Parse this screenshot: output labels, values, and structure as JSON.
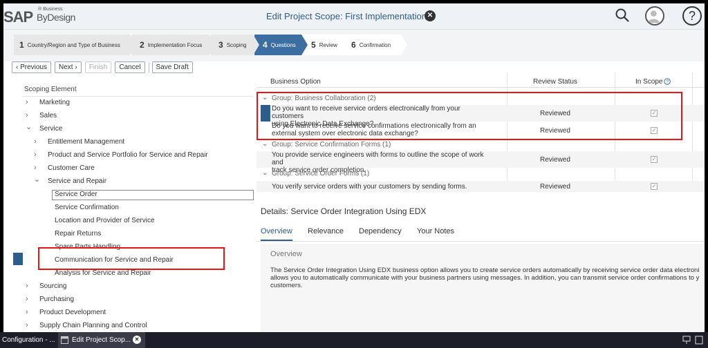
{
  "shell": {
    "logo_sap": "SAP",
    "logo_super": "® Business",
    "logo_sub": "ByDesign",
    "title": "Edit Project Scope: First Implementation",
    "close_glyph": "✕",
    "help_glyph": "?"
  },
  "roadmap": [
    {
      "num": "1",
      "label": "Country/Region and Type of Business",
      "state": "done"
    },
    {
      "num": "2",
      "label": "Implementation Focus",
      "state": "done"
    },
    {
      "num": "3",
      "label": "Scoping",
      "state": "done"
    },
    {
      "num": "4",
      "label": "Questions",
      "state": "active"
    },
    {
      "num": "5",
      "label": "Review",
      "state": "future"
    },
    {
      "num": "6",
      "label": "Confirmation",
      "state": "future"
    }
  ],
  "toolbar": {
    "previous": "‹ Previous",
    "next": "Next ›",
    "finish": "Finish",
    "cancel": "Cancel",
    "save_draft": "Save Draft"
  },
  "tree": {
    "header": "Scoping Element",
    "items": [
      {
        "label": "Marketing",
        "arrow": "›",
        "level": 0
      },
      {
        "label": "Sales",
        "arrow": "›",
        "level": 0
      },
      {
        "label": "Service",
        "arrow": "⌄",
        "level": 0
      },
      {
        "label": "Entitlement Management",
        "arrow": "›",
        "level": 1
      },
      {
        "label": "Product and Service Portfolio for Service and Repair",
        "arrow": "›",
        "level": 1
      },
      {
        "label": "Customer Care",
        "arrow": "›",
        "level": 1
      },
      {
        "label": "Service and Repair",
        "arrow": "⌄",
        "level": 1
      },
      {
        "label": "Service Order",
        "arrow": "",
        "level": 2
      },
      {
        "label": "Service Confirmation",
        "arrow": "",
        "level": 2
      },
      {
        "label": "Location and Provider of Service",
        "arrow": "",
        "level": 2
      },
      {
        "label": "Repair Returns",
        "arrow": "",
        "level": 2
      },
      {
        "label": "Spare Parts Handling",
        "arrow": "",
        "level": 2
      },
      {
        "label": "Communication for Service and Repair",
        "arrow": "",
        "level": 2
      },
      {
        "label": "Analysis for Service and Repair",
        "arrow": "",
        "level": 2
      },
      {
        "label": "Sourcing",
        "arrow": "›",
        "level": 0
      },
      {
        "label": "Purchasing",
        "arrow": "›",
        "level": 0
      },
      {
        "label": "Product Development",
        "arrow": "›",
        "level": 0
      },
      {
        "label": "Supply Chain Planning and Control",
        "arrow": "›",
        "level": 0
      }
    ]
  },
  "table": {
    "col_option": "Business Option",
    "col_status": "Review Status",
    "col_scope": "In Scope",
    "groups": [
      {
        "label": "Group: Business Collaboration (2)",
        "rows": [
          {
            "line1": "Do you want to receive service orders electronically from your customers",
            "line2": "using Electronic Data Exchange?",
            "status": "Reviewed",
            "in_scope": "✓"
          },
          {
            "line1": "Do you want to receive service confirmations electronically from an",
            "line2": "external system over electronic data exchange?",
            "status": "Reviewed",
            "in_scope": "✓"
          }
        ]
      },
      {
        "label": "Group: Service Confirmation Forms (1)",
        "rows": [
          {
            "line1": "You provide service engineers with forms to outline the scope of work and",
            "line2": "track service order completion.",
            "status": "Reviewed",
            "in_scope": "✓"
          }
        ]
      },
      {
        "label": "Group: Service Order Forms (1)",
        "rows": [
          {
            "line1": "You verify service orders with your customers by sending forms.",
            "line2": "",
            "status": "Reviewed",
            "in_scope": "✓"
          }
        ]
      }
    ]
  },
  "details": {
    "title": "Details: Service Order Integration Using EDX",
    "tabs": [
      "Overview",
      "Relevance",
      "Dependency",
      "Your Notes"
    ],
    "overview_title": "Overview",
    "overview_lines": [
      "The Service Order Integration Using EDX business option allows you to create service orders automatically by receiving service order data electroni",
      "allows you to automatically communicate with your business partners using messages. In addition, you can transmit service order confirmations to y",
      "customers."
    ]
  },
  "taskbar": {
    "item1": "Configuration - ...",
    "item2": "Edit Project Scop..."
  },
  "colors": {
    "accent": "#2d5d8a",
    "active_step": "#3b6fa1",
    "highlight_box": "#ee1111"
  }
}
